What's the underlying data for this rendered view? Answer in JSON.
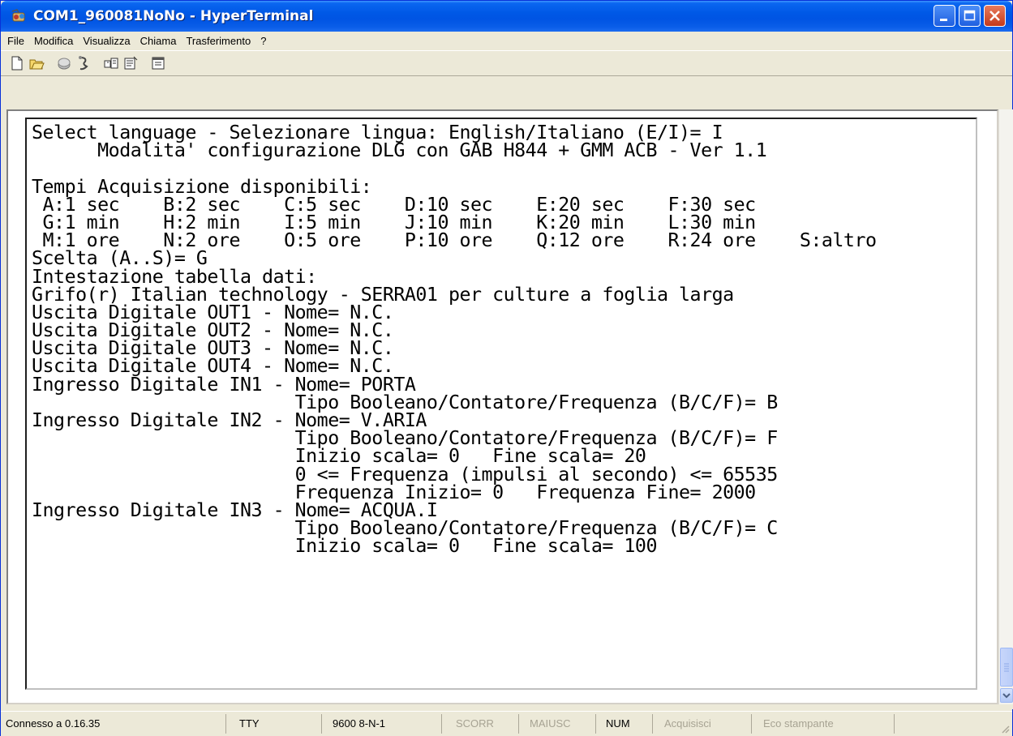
{
  "window": {
    "title": "COM1_960081NoNo - HyperTerminal"
  },
  "menu": {
    "items": [
      "File",
      "Modifica",
      "Visualizza",
      "Chiama",
      "Trasferimento",
      "?"
    ]
  },
  "toolbar": {
    "icons": [
      "new-icon",
      "open-icon",
      "disconnect-icon",
      "call-icon",
      "send-icon",
      "receive-icon",
      "properties-icon"
    ]
  },
  "terminal": {
    "lines": [
      "Select language - Selezionare lingua: English/Italiano (E/I)= I",
      "      Modalita' configurazione DLG con GAB H844 + GMM ACB - Ver 1.1",
      "",
      "Tempi Acquisizione disponibili:",
      " A:1 sec    B:2 sec    C:5 sec    D:10 sec    E:20 sec    F:30 sec",
      " G:1 min    H:2 min    I:5 min    J:10 min    K:20 min    L:30 min",
      " M:1 ore    N:2 ore    O:5 ore    P:10 ore    Q:12 ore    R:24 ore    S:altro",
      "Scelta (A..S)= G",
      "Intestazione tabella dati:",
      "Grifo(r) Italian technology - SERRA01 per culture a foglia larga",
      "Uscita Digitale OUT1 - Nome= N.C.",
      "Uscita Digitale OUT2 - Nome= N.C.",
      "Uscita Digitale OUT3 - Nome= N.C.",
      "Uscita Digitale OUT4 - Nome= N.C.",
      "Ingresso Digitale IN1 - Nome= PORTA",
      "                        Tipo Booleano/Contatore/Frequenza (B/C/F)= B",
      "Ingresso Digitale IN2 - Nome= V.ARIA",
      "                        Tipo Booleano/Contatore/Frequenza (B/C/F)= F",
      "                        Inizio scala= 0   Fine scala= 20",
      "                        0 <= Frequenza (impulsi al secondo) <= 65535",
      "                        Frequenza Inizio= 0   Frequenza Fine= 2000",
      "Ingresso Digitale IN3 - Nome= ACQUA.I",
      "                        Tipo Booleano/Contatore/Frequenza (B/C/F)= C",
      "                        Inizio scala= 0   Fine scala= 100"
    ]
  },
  "statusbar": {
    "connection": "Connesso a 0.16.35",
    "emulation": "TTY",
    "port_settings": "9600 8-N-1",
    "scroll": "SCORR",
    "caps": "MAIUSC",
    "num": "NUM",
    "capture": "Acquisisci",
    "print_echo": "Eco stampante"
  }
}
